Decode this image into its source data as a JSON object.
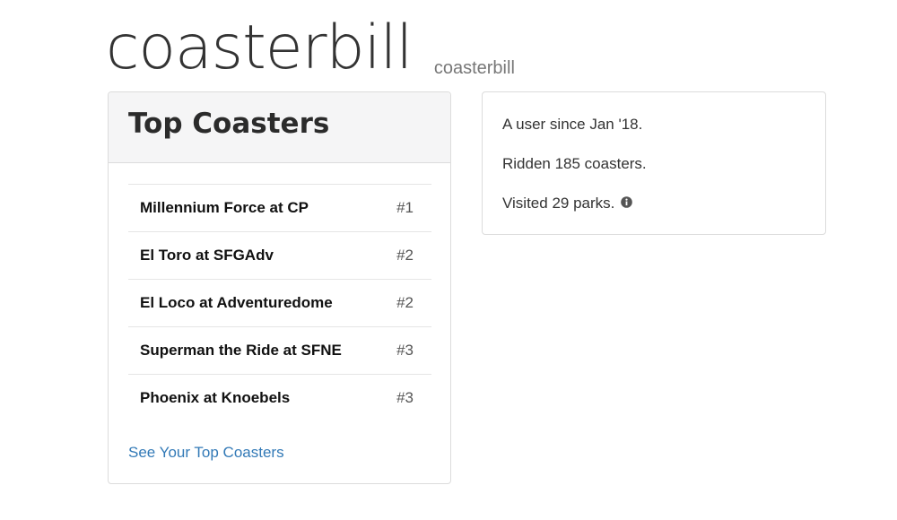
{
  "header": {
    "title": "coasterbill",
    "subtitle": "coasterbill"
  },
  "top_coasters": {
    "title": "Top Coasters",
    "items": [
      {
        "name": "Millennium Force at CP",
        "rank": "#1"
      },
      {
        "name": "El Toro at SFGAdv",
        "rank": "#2"
      },
      {
        "name": "El Loco at Adventuredome",
        "rank": "#2"
      },
      {
        "name": "Superman the Ride at SFNE",
        "rank": "#3"
      },
      {
        "name": "Phoenix at Knoebels",
        "rank": "#3"
      }
    ],
    "link_label": "See Your Top Coasters"
  },
  "stats": {
    "since": "A user since Jan '18.",
    "ridden": "Ridden 185 coasters.",
    "visited": "Visited 29 parks."
  },
  "colors": {
    "link": "#337ab7",
    "card_header_bg": "#f5f5f6",
    "border": "#dcdcdc"
  },
  "icons": {
    "visited_info": "info-circle-icon"
  }
}
